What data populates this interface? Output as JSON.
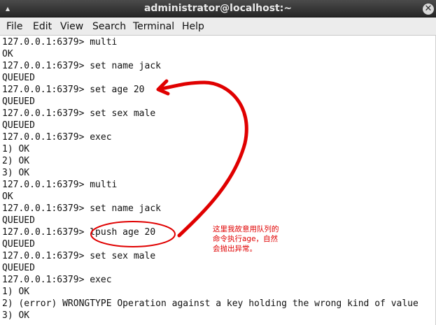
{
  "window": {
    "title": "administrator@localhost:~",
    "close_symbol": "✕",
    "scroll_symbol": "▴"
  },
  "menu": {
    "items": [
      {
        "label": "File"
      },
      {
        "label": "Edit"
      },
      {
        "label": "View"
      },
      {
        "label": "Search"
      },
      {
        "label": "Terminal"
      },
      {
        "label": "Help"
      }
    ]
  },
  "terminal": {
    "lines": [
      "127.0.0.1:6379> multi",
      "OK",
      "127.0.0.1:6379> set name jack",
      "QUEUED",
      "127.0.0.1:6379> set age 20",
      "QUEUED",
      "127.0.0.1:6379> set sex male",
      "QUEUED",
      "127.0.0.1:6379> exec",
      "1) OK",
      "2) OK",
      "3) OK",
      "127.0.0.1:6379> multi",
      "OK",
      "127.0.0.1:6379> set name jack",
      "QUEUED",
      "127.0.0.1:6379> lpush age 20",
      "QUEUED",
      "127.0.0.1:6379> set sex male",
      "QUEUED",
      "127.0.0.1:6379> exec",
      "1) OK",
      "2) (error) WRONGTYPE Operation against a key holding the wrong kind of value",
      "3) OK"
    ]
  },
  "annotation": {
    "note_lines": [
      "这里我故意用队列的",
      "命令执行age，自然",
      "会抛出异常。"
    ],
    "color": "#e00000"
  }
}
